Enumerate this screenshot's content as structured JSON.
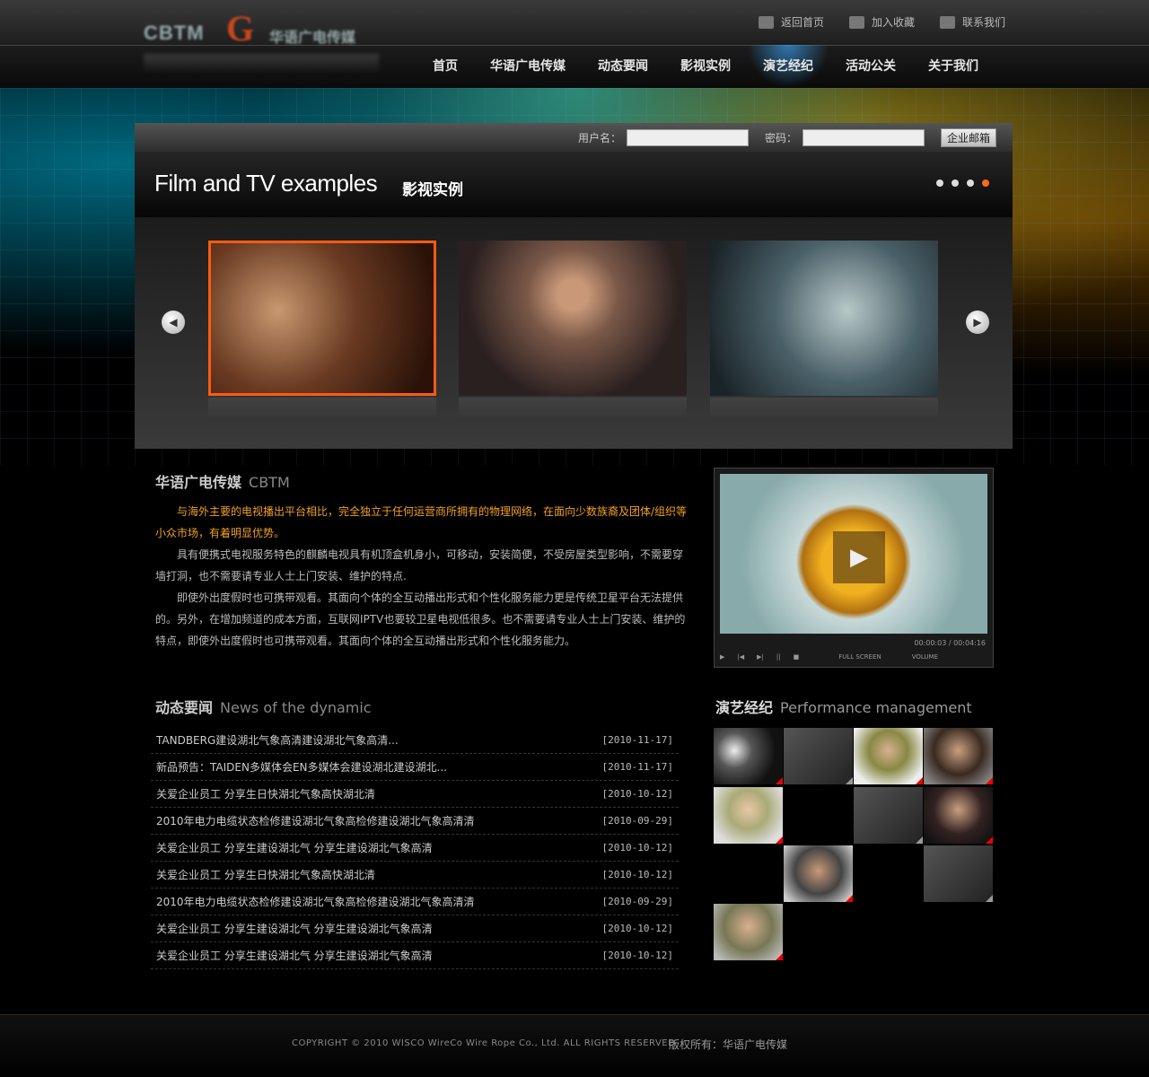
{
  "toplinks": [
    {
      "label": "返回首页",
      "icon": "home-icon"
    },
    {
      "label": "加入收藏",
      "icon": "envelope-icon"
    },
    {
      "label": "联系我们",
      "icon": "chat-icon"
    }
  ],
  "nav": [
    "首页",
    "华语广电传媒",
    "动态要闻",
    "影视实例",
    "演艺经纪",
    "活动公关",
    "关于我们"
  ],
  "nav_active": "演艺经纪",
  "login": {
    "username_label": "用户名：",
    "password_label": "密码：",
    "button": "企业邮箱"
  },
  "feature": {
    "title_en": "Film and TV examples",
    "title_cn": "影视实例"
  },
  "cbtm": {
    "title": "华语广电传媒",
    "title_en": "CBTM",
    "p1": "与海外主要的电视播出平台相比，完全独立于任何运营商所拥有的物理网络，在面向少数族裔及团体/组织等小众市场，有着明显优势。",
    "p2": "具有便携式电视服务特色的麒麟电视具有机顶盒机身小，可移动，安装简便，不受房屋类型影响，不需要穿墙打洞，也不需要请专业人士上门安装、维护的特点.",
    "p3": "即使外出度假时也可携带观看。其面向个体的全互动播出形式和个性化服务能力更是传统卫星平台无法提供的。另外，在增加频道的成本方面，互联网IPTV也要较卫星电视低很多。也不需要请专业人士上门安装、维护的特点，即使外出度假时也可携带观看。其面向个体的全互动播出形式和个性化服务能力。"
  },
  "video": {
    "time": "00:00:03 / 00:04:16",
    "fullscreen": "FULL SCREEN",
    "volume": "VOLUME"
  },
  "news": {
    "title": "动态要闻",
    "title_en": "News of the dynamic",
    "items": [
      {
        "t": "TANDBERG建设湖北气象高清建设湖北气象高清...",
        "d": "[2010-11-17]"
      },
      {
        "t": "新品预告：TAIDEN多媒体会EN多媒体会建设湖北建设湖北...",
        "d": "[2010-11-17]"
      },
      {
        "t": "关爱企业员工 分享生日快湖北气象高快湖北清",
        "d": "[2010-10-12]"
      },
      {
        "t": "2010年电力电缆状态检修建设湖北气象高检修建设湖北气象高清清",
        "d": "[2010-09-29]"
      },
      {
        "t": "关爱企业员工 分享生建设湖北气 分享生建设湖北气象高清",
        "d": "[2010-10-12]"
      },
      {
        "t": "关爱企业员工 分享生日快湖北气象高快湖北清",
        "d": "[2010-10-12]"
      },
      {
        "t": "2010年电力电缆状态检修建设湖北气象高检修建设湖北气象高清清",
        "d": "[2010-09-29]"
      },
      {
        "t": "关爱企业员工 分享生建设湖北气 分享生建设湖北气象高清",
        "d": "[2010-10-12]"
      },
      {
        "t": "关爱企业员工 分享生建设湖北气 分享生建设湖北气象高清",
        "d": "[2010-10-12]"
      }
    ]
  },
  "perf": {
    "title": "演艺经纪",
    "title_en": "Performance management"
  },
  "footer": {
    "copyright": "COPYRIGHT © 2010 WISCO WireCo Wire Rope Co., Ltd. ALL RIGHTS RESERVED",
    "owner": "版权所有：华语广电传媒"
  }
}
